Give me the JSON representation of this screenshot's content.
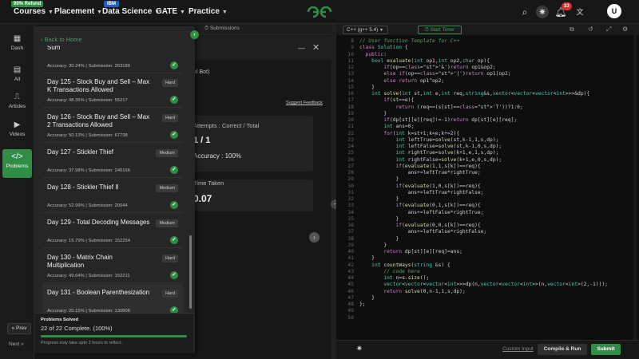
{
  "topnav": {
    "refund_badge": "90% Refund",
    "courses": "Courses",
    "placement": "Placement",
    "ibm_badge": "IBM",
    "data_science": "Data Science",
    "gate": "GATE",
    "practice": "Practice",
    "notification_count": "33",
    "avatar_letter": "U"
  },
  "sidebar": {
    "items": [
      {
        "label": "Dash",
        "icon": "dashboard-icon"
      },
      {
        "label": "All",
        "icon": "grid-icon"
      },
      {
        "label": "Articles",
        "icon": "book-icon"
      },
      {
        "label": "Videos",
        "icon": "video-icon"
      },
      {
        "label": "Problems",
        "icon": "code-icon"
      }
    ],
    "prev": "« Prev",
    "next": "Next »"
  },
  "background": {
    "tab_submissions": "Submissions",
    "bot_label": "ıl Bot)",
    "suggest_feedback": "Suggest Feedback",
    "attempts_label": "Attempts : Correct / Total",
    "attempts_value": "1 / 1",
    "accuracy_label": "Accuracy : 100%",
    "time_taken_label": "Time Taken",
    "time_taken_value": "0.07"
  },
  "drawer": {
    "back_label": "Back to Home",
    "items": [
      {
        "title": "Sum",
        "difficulty": "",
        "meta": "Accuracy: 30.24% | Submission: 263180"
      },
      {
        "title": "Day 125 - Stock Buy and Sell – Max K Transactions Allowed",
        "difficulty": "Hard",
        "meta": "Accuracy: 48.35% | Submission: 55217"
      },
      {
        "title": "Day 126 - Stock Buy and Sell – Max 2 Transactions Allowed",
        "difficulty": "Hard",
        "meta": "Accuracy: 50.13% | Submission: 67738"
      },
      {
        "title": "Day 127 - Stickler Thief",
        "difficulty": "Medium",
        "meta": "Accuracy: 37.98% | Submission: 246166"
      },
      {
        "title": "Day 128 - Stickler Thief II",
        "difficulty": "Medium",
        "meta": "Accuracy: 52.99% | Submission: 20044"
      },
      {
        "title": "Day 129 - Total Decoding Messages",
        "difficulty": "Medium",
        "meta": "Accuracy: 15.79% | Submission: 152254"
      },
      {
        "title": "Day 130 - Matrix Chain Multiplication",
        "difficulty": "Hard",
        "meta": "Accuracy: 49.64% | Submission: 152211"
      },
      {
        "title": "Day 131 - Boolean Parenthesization",
        "difficulty": "Hard",
        "meta": "Accuracy: 20.15% | Submission: 130806"
      }
    ],
    "solved_title": "Problems Solved",
    "solved_count": "22 of 22 Complete. (100%)",
    "solved_progress": 1.0,
    "solved_note": "Progress may take upto 2 hours to reflect."
  },
  "editor": {
    "language": "C++ (g++ 5.4)",
    "start_timer": "Start Timer",
    "custom_input": "Custom Input",
    "compile_run": "Compile & Run",
    "submit": "Submit",
    "lines": [
      {
        "n": "8",
        "t": "// User function Template for C++"
      },
      {
        "n": "9",
        "t": "class Solution {"
      },
      {
        "n": "10",
        "t": "  public:"
      },
      {
        "n": "11",
        "t": "    bool evaluate(int op1,int op2,char op){"
      },
      {
        "n": "12",
        "t": "        if(op=='&')return op1&op2;"
      },
      {
        "n": "13",
        "t": "        else if(op=='|')return op1|op2;"
      },
      {
        "n": "14",
        "t": "        else return op1^op2;"
      },
      {
        "n": "15",
        "t": "    }"
      },
      {
        "n": "16",
        "t": "    int solve(int st,int e,int req,string&s,vector<vector<vector<int>>>&dp){"
      },
      {
        "n": "17",
        "t": "        if(st==e){"
      },
      {
        "n": "18",
        "t": "            return (req==(s[st]=='T'))?1:0;"
      },
      {
        "n": "19",
        "t": "        }"
      },
      {
        "n": "20",
        "t": "        if(dp[st][e][req]!=-1)return dp[st][e][req];"
      },
      {
        "n": "21",
        "t": "        int ans=0;"
      },
      {
        "n": "22",
        "t": "        for(int k=st+1;k<e;k+=2){"
      },
      {
        "n": "23",
        "t": "            int leftTrue=solve(st,k-1,1,s,dp);"
      },
      {
        "n": "24",
        "t": "            int leftFalse=solve(st,k-1,0,s,dp);"
      },
      {
        "n": "25",
        "t": "            int rightTrue=solve(k+1,e,1,s,dp);"
      },
      {
        "n": "26",
        "t": "            int rightFalse=solve(k+1,e,0,s,dp);"
      },
      {
        "n": "27",
        "t": "            if(evaluate(1,1,s[k])==req){"
      },
      {
        "n": "28",
        "t": "                ans+=leftTrue*rightTrue;"
      },
      {
        "n": "29",
        "t": "            }"
      },
      {
        "n": "30",
        "t": "            if(evaluate(1,0,s[k])==req){"
      },
      {
        "n": "31",
        "t": "                ans+=leftTrue*rightFalse;"
      },
      {
        "n": "32",
        "t": "            }"
      },
      {
        "n": "33",
        "t": "            if(evaluate(0,1,s[k])==req){"
      },
      {
        "n": "34",
        "t": "                ans+=leftFalse*rightTrue;"
      },
      {
        "n": "35",
        "t": "            }"
      },
      {
        "n": "36",
        "t": "            if(evaluate(0,0,s[k])==req){"
      },
      {
        "n": "37",
        "t": "                ans+=leftFalse*rightFalse;"
      },
      {
        "n": "38",
        "t": "            }"
      },
      {
        "n": "39",
        "t": "        }"
      },
      {
        "n": "40",
        "t": "        return dp[st][e][req]=ans;"
      },
      {
        "n": "41",
        "t": "    }"
      },
      {
        "n": "42",
        "t": "    int countWays(string &s) {"
      },
      {
        "n": "43",
        "t": "        // code here"
      },
      {
        "n": "44",
        "t": "        int n=s.size();"
      },
      {
        "n": "45",
        "t": "        vector<vector<vector<int>>>dp(n,vector<vector<int>>(n,vector<int>(2,-1)));"
      },
      {
        "n": "46",
        "t": "        return solve(0,n-1,1,s,dp);"
      },
      {
        "n": "47",
        "t": "    }"
      },
      {
        "n": "48",
        "t": "};"
      },
      {
        "n": "49",
        "t": ""
      },
      {
        "n": "50",
        "t": ""
      }
    ]
  },
  "colors": {
    "accent": "#2f8d46",
    "background": "#131313",
    "drawer": "#262626"
  }
}
